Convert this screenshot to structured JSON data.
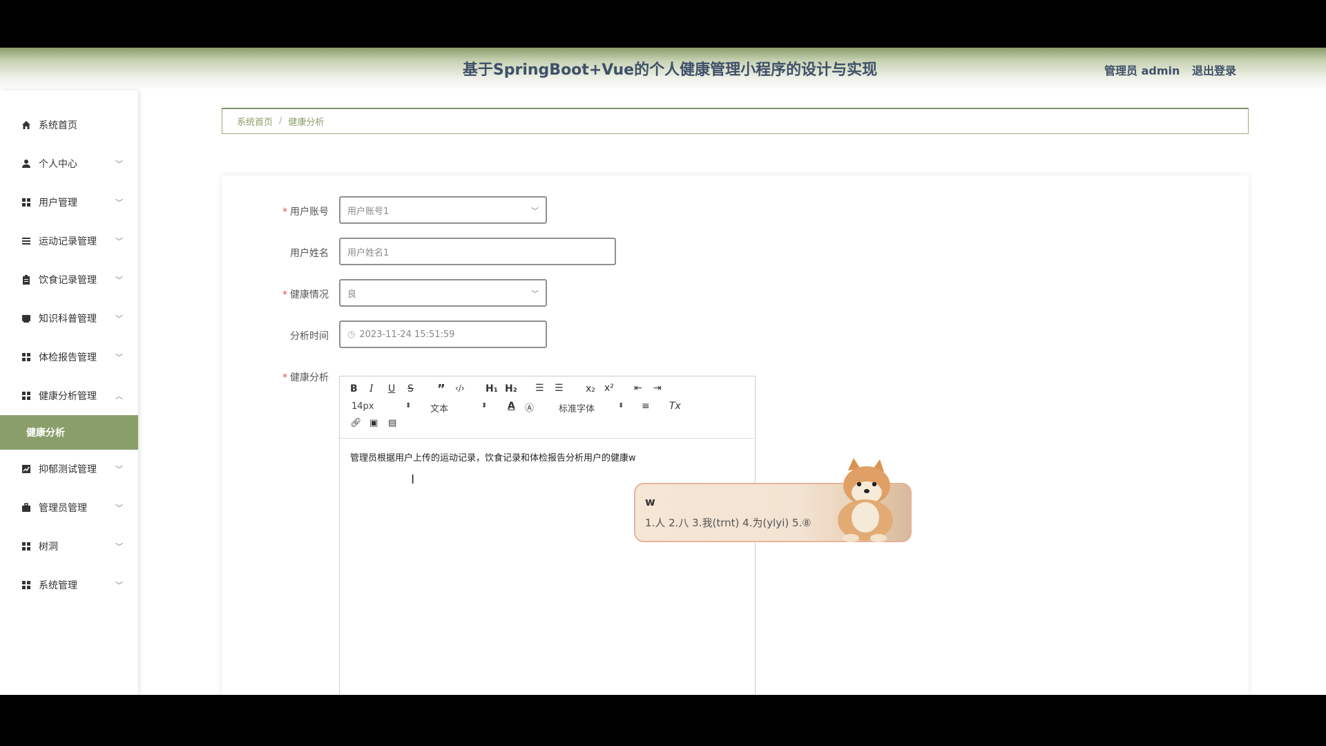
{
  "header": {
    "title": "基于SpringBoot+Vue的个人健康管理小程序的设计与实现",
    "role": "管理员 admin",
    "logout": "退出登录"
  },
  "sidebar": {
    "items": [
      {
        "label": "系统首页",
        "icon": "home-icon"
      },
      {
        "label": "个人中心",
        "icon": "user-icon"
      },
      {
        "label": "用户管理",
        "icon": "grid-icon"
      },
      {
        "label": "运动记录管理",
        "icon": "list-icon"
      },
      {
        "label": "饮食记录管理",
        "icon": "clipboard-icon"
      },
      {
        "label": "知识科普管理",
        "icon": "book-icon"
      },
      {
        "label": "体检报告管理",
        "icon": "grid-icon"
      },
      {
        "label": "健康分析管理",
        "icon": "grid-icon"
      },
      {
        "label": "抑郁测试管理",
        "icon": "chart-icon"
      },
      {
        "label": "管理员管理",
        "icon": "briefcase-icon"
      },
      {
        "label": "树洞",
        "icon": "grid-icon"
      },
      {
        "label": "系统管理",
        "icon": "grid-icon"
      }
    ],
    "active_sub": "健康分析"
  },
  "breadcrumb": {
    "home": "系统首页",
    "sep": "/",
    "current": "健康分析"
  },
  "form": {
    "account_label": "用户账号",
    "account_value": "用户账号1",
    "name_label": "用户姓名",
    "name_value": "用户姓名1",
    "health_label": "健康情况",
    "health_value": "良",
    "time_label": "分析时间",
    "time_value": "2023-11-24 15:51:59",
    "analysis_label": "健康分析"
  },
  "editor": {
    "font_size": "14px",
    "text_type": "文本",
    "font_family": "标准字体",
    "content": "管理员根据用户上传的运动记录，饮食记录和体检报告分析用户的健康w"
  },
  "ime": {
    "input": "w",
    "candidates": "1.人  2.八  3.我(trnt)  4.为(ylyi)  5.⑧"
  },
  "colors": {
    "accent": "#8a9e6a",
    "title": "#3f5068",
    "required": "#e74c3c"
  }
}
